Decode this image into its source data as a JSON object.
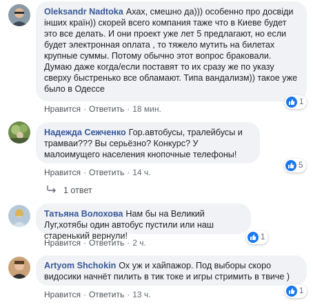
{
  "comments": [
    {
      "author": "Oleksandr Nadtoka",
      "text": "Ахах, смешно да))) особенно про досвіди інших країн)) скорей всего компания таже что в Киеве будет это все делать. И они проект уже лет 5 предлагают, но если будет электронная оплата , то тяжело мутить на билетах крупные суммы. Потому обычно этот вопрос браковали. Думаю даже когда/если поставят то их сразу же по указу сверху быстренько все обламают. Типа вандализм)) такое уже было в Одессе",
      "like_label": "Нравится",
      "reply_label": "Ответить",
      "time": "18 мин.",
      "reactions": "1"
    },
    {
      "author": "Надежда Сежченко",
      "text": "Гор.автобусы, тралейбусы и трамваи??? Вы серьёзно? Конкурс? У малоимущего населения кнопочные телефоны!",
      "like_label": "Нравится",
      "reply_label": "Ответить",
      "time": "14 ч.",
      "reactions": "5",
      "replies_label": "1 ответ"
    },
    {
      "author": "Татьяна Волохова",
      "text": "Нам бы на Великий Луг,хотябы один автобус пустили или наш старенький вернули!",
      "like_label": "Нравится",
      "reply_label": "Ответить",
      "time": "2 ч.",
      "reactions": "1"
    },
    {
      "author": "Artyom Shchokin",
      "text": "Ох уж и хайпажор. Под выборы скоро видосики начнёт пилить в тик токе и игры стримить в твиче )",
      "like_label": "Нравится",
      "reply_label": "Ответить",
      "time": "13 ч.",
      "reactions": "1"
    }
  ],
  "colors": {
    "author": "#385898",
    "bubble": "#f0f2f5",
    "like_blue": "#1877f2"
  },
  "icons": [
    "avatar",
    "like-icon",
    "reply-arrow-icon"
  ]
}
